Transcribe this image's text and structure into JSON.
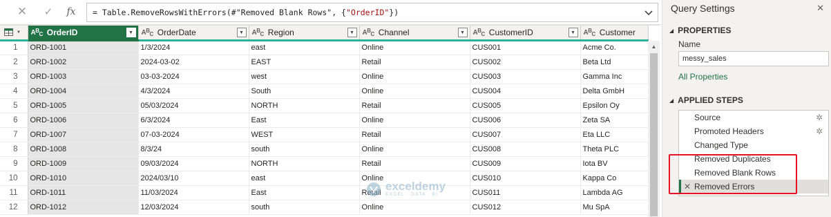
{
  "formula_bar": {
    "formula_prefix": "= Table.RemoveRowsWithErrors(#",
    "formula_step": "\"Removed Blank Rows\"",
    "formula_mid": ", {",
    "formula_col": "\"OrderID\"",
    "formula_suffix": "})",
    "fx_label": "fx"
  },
  "grid": {
    "columns": [
      {
        "label": "OrderID",
        "type": "text"
      },
      {
        "label": "OrderDate",
        "type": "text"
      },
      {
        "label": "Region",
        "type": "text"
      },
      {
        "label": "Channel",
        "type": "text"
      },
      {
        "label": "CustomerID",
        "type": "text"
      },
      {
        "label": "Customer",
        "type": "text"
      }
    ],
    "rows": [
      {
        "n": "1",
        "cells": [
          "ORD-1001",
          "1/3/2024",
          "east",
          "Online",
          "CUS001",
          "Acme Co."
        ]
      },
      {
        "n": "2",
        "cells": [
          "ORD-1002",
          "2024-03-02",
          "EAST",
          "Retail",
          "CUS002",
          "Beta Ltd"
        ]
      },
      {
        "n": "3",
        "cells": [
          "ORD-1003",
          "03-03-2024",
          "west",
          "Online",
          "CUS003",
          "Gamma Inc"
        ]
      },
      {
        "n": "4",
        "cells": [
          "ORD-1004",
          "4/3/2024",
          "South",
          "Online",
          "CUS004",
          "Delta GmbH"
        ]
      },
      {
        "n": "5",
        "cells": [
          "ORD-1005",
          "05/03/2024",
          "NORTH",
          "Retail",
          "CUS005",
          "Epsilon Oy"
        ]
      },
      {
        "n": "6",
        "cells": [
          "ORD-1006",
          "6/3/2024",
          "East",
          "Online",
          "CUS006",
          "Zeta SA"
        ]
      },
      {
        "n": "7",
        "cells": [
          "ORD-1007",
          "07-03-2024",
          "WEST",
          "Retail",
          "CUS007",
          "Eta LLC"
        ]
      },
      {
        "n": "8",
        "cells": [
          "ORD-1008",
          "8/3/24",
          "south",
          "Online",
          "CUS008",
          "Theta PLC"
        ]
      },
      {
        "n": "9",
        "cells": [
          "ORD-1009",
          "09/03/2024",
          "NORTH",
          "Retail",
          "CUS009",
          "Iota BV"
        ]
      },
      {
        "n": "10",
        "cells": [
          "ORD-1010",
          "2024/03/10",
          "east",
          "Online",
          "CUS010",
          "Kappa Co"
        ]
      },
      {
        "n": "11",
        "cells": [
          "ORD-1011",
          "11/03/2024",
          "East",
          "Retail",
          "CUS011",
          "Lambda AG"
        ]
      },
      {
        "n": "12",
        "cells": [
          "ORD-1012",
          "12/03/2024",
          "south",
          "Online",
          "CUS012",
          "Mu SpA"
        ]
      }
    ]
  },
  "watermark": {
    "name": "exceldemy",
    "tagline": "EXCEL · DATA · BI"
  },
  "settings": {
    "title": "Query Settings",
    "properties_header": "PROPERTIES",
    "name_label": "Name",
    "name_value": "messy_sales",
    "all_properties": "All Properties",
    "applied_steps_header": "APPLIED STEPS",
    "steps": [
      {
        "label": "Source",
        "has_gear": true,
        "active": false
      },
      {
        "label": "Promoted Headers",
        "has_gear": true,
        "active": false
      },
      {
        "label": "Changed Type",
        "has_gear": false,
        "active": false
      },
      {
        "label": "Removed Duplicates",
        "has_gear": false,
        "active": false
      },
      {
        "label": "Removed Blank Rows",
        "has_gear": false,
        "active": false
      },
      {
        "label": "Removed Errors",
        "has_gear": false,
        "active": true
      }
    ]
  },
  "colors": {
    "accent": "#217346",
    "header_rule": "#2bb09a",
    "highlight": "#e81123"
  }
}
